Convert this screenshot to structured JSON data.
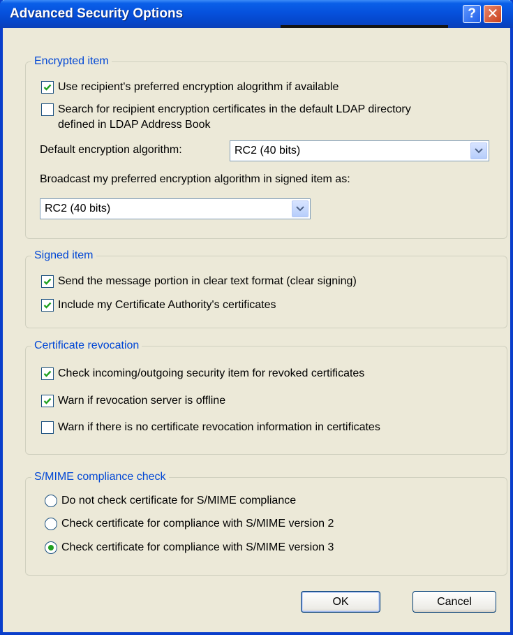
{
  "window": {
    "title": "Advanced Security Options",
    "help_button": "?",
    "close_button": "✕"
  },
  "encrypted_item": {
    "legend": "Encrypted item",
    "use_preferred_label": "Use recipient's preferred encryption alogrithm if available",
    "use_preferred_checked": true,
    "search_ldap_label_line1": "Search for recipient encryption certificates in the default LDAP directory",
    "search_ldap_label_line2": "defined in LDAP Address Book",
    "search_ldap_checked": false,
    "default_algorithm_label": "Default encryption algorithm:",
    "default_algorithm_value": "RC2 (40 bits)",
    "broadcast_label": "Broadcast my preferred encryption algorithm in signed item as:",
    "broadcast_value": "RC2 (40 bits)"
  },
  "signed_item": {
    "legend": "Signed item",
    "clear_signing_label": "Send the message portion in clear text format (clear signing)",
    "clear_signing_checked": true,
    "include_ca_label": "Include my Certificate Authority's certificates",
    "include_ca_checked": true
  },
  "certificate_revocation": {
    "legend": "Certificate revocation",
    "check_revoked_label": "Check incoming/outgoing security item for revoked certificates",
    "check_revoked_checked": true,
    "warn_offline_label": "Warn if revocation server is offline",
    "warn_offline_checked": true,
    "warn_no_info_label": "Warn if there is no certificate revocation information in certificates",
    "warn_no_info_checked": false
  },
  "smime": {
    "legend": "S/MIME compliance check",
    "options": [
      {
        "label": "Do not check certificate for S/MIME compliance",
        "selected": false
      },
      {
        "label": "Check certificate for compliance with S/MIME version 2",
        "selected": false
      },
      {
        "label": "Check certificate for compliance with S/MIME version 3",
        "selected": true
      }
    ]
  },
  "buttons": {
    "ok_label": "OK",
    "cancel_label": "Cancel"
  },
  "colors": {
    "title_bar": "#0a5fe8",
    "group_legend": "#0046d5",
    "check_mark": "#21a121",
    "dialog_bg": "#ece9d8"
  },
  "icons": {
    "check": "check-icon",
    "dropdown": "chevron-down-icon",
    "help": "help-icon",
    "close": "close-icon"
  }
}
